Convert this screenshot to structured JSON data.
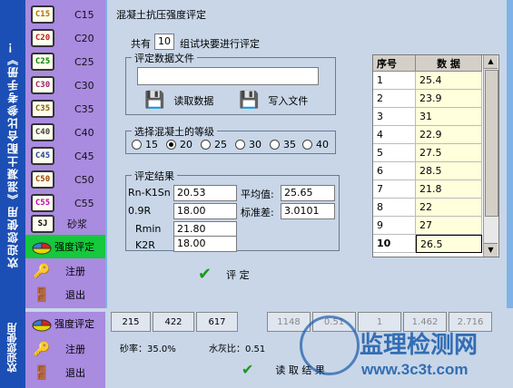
{
  "banner": {
    "text": "欢迎您使用《混凝土配合比参考手册》！",
    "text2": "欢迎您使用"
  },
  "sidebar": {
    "grades": [
      {
        "icon": "C15",
        "label": "C15"
      },
      {
        "icon": "C20",
        "label": "C20"
      },
      {
        "icon": "C25",
        "label": "C25"
      },
      {
        "icon": "C30",
        "label": "C30"
      },
      {
        "icon": "C35",
        "label": "C35"
      },
      {
        "icon": "C40",
        "label": "C40"
      },
      {
        "icon": "C45",
        "label": "C45"
      },
      {
        "icon": "C50",
        "label": "C50"
      },
      {
        "icon": "C55",
        "label": "C55"
      },
      {
        "icon": "SJ",
        "label": "砂浆"
      }
    ],
    "strength_label": "强度评定",
    "register_label": "注册",
    "exit_label": "退出"
  },
  "main": {
    "title": "混凝土抗压强度评定",
    "count_prefix": "共有",
    "count_value": "10",
    "count_suffix": "组试块要进行评定",
    "file_group": "评定数据文件",
    "file_path": "",
    "read_label": "读取数据",
    "write_label": "写入文件",
    "grade_group": "选择混凝土的等级",
    "grade_options": [
      "15",
      "20",
      "25",
      "30",
      "35",
      "40"
    ],
    "grade_selected": "20",
    "result_group": "评定结果",
    "results": {
      "rn_label": "Rn-K1Sn",
      "rn_value": "20.53",
      "r09_label": "0.9R",
      "r09_value": "18.00",
      "rmin_label": "Rmin",
      "rmin_value": "21.80",
      "k2r_label": "K2R",
      "k2r_value": "18.00",
      "mean_label": "平均值:",
      "mean_value": "25.65",
      "std_label": "标准差:",
      "std_value": "3.0101"
    },
    "evaluate_label": "评  定"
  },
  "table": {
    "headers": [
      "序号",
      "数  据"
    ],
    "rows": [
      {
        "idx": "1",
        "val": "25.4"
      },
      {
        "idx": "2",
        "val": "23.9"
      },
      {
        "idx": "3",
        "val": "31"
      },
      {
        "idx": "4",
        "val": "22.9"
      },
      {
        "idx": "5",
        "val": "27.5"
      },
      {
        "idx": "6",
        "val": "28.5"
      },
      {
        "idx": "7",
        "val": "21.8"
      },
      {
        "idx": "8",
        "val": "22"
      },
      {
        "idx": "9",
        "val": "27"
      },
      {
        "idx": "10",
        "val": "26.5"
      }
    ]
  },
  "bottom": {
    "cells": [
      "215",
      "422",
      "617",
      "1148",
      "0.51",
      "1",
      "1.462",
      "2.716"
    ],
    "sand_ratio": "砂率：35.0%",
    "wc_ratio": "水灰比：0.51",
    "read_result_label": "读 取 结 果",
    "strength_label": "强度评定",
    "register_label": "注册",
    "exit_label": "退出"
  },
  "watermark": {
    "cn": "监理检测网",
    "url": "www.3c3t.com"
  },
  "colors": {
    "banner": "#1c4fb5",
    "sidebar": "#a98be0",
    "active": "#16c83c",
    "panel": "#c8d6e8",
    "cell_yellow": "#ffffdc"
  }
}
